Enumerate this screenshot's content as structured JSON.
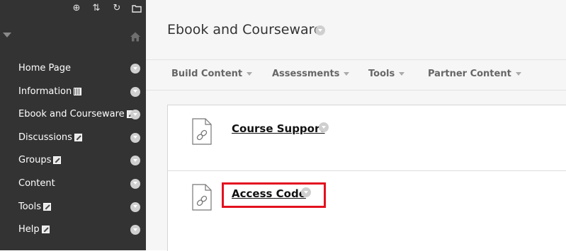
{
  "sidebar": {
    "tools": [
      {
        "icon": "add-circle-icon",
        "glyph": "⊕"
      },
      {
        "icon": "reorder-arrows-icon",
        "glyph": "⇅"
      },
      {
        "icon": "refresh-icon",
        "glyph": "↻"
      },
      {
        "icon": "folder-icon",
        "glyph": "▭"
      }
    ],
    "items": [
      {
        "label": "Home Page",
        "icon": null
      },
      {
        "label": "Information",
        "icon": "grid"
      },
      {
        "label": "Ebook and Courseware",
        "icon": "pencil"
      },
      {
        "label": "Discussions",
        "icon": "pencil"
      },
      {
        "label": "Groups",
        "icon": "pencil"
      },
      {
        "label": "Content",
        "icon": null
      },
      {
        "label": "Tools",
        "icon": "pencil"
      },
      {
        "label": "Help",
        "icon": "pencil"
      }
    ]
  },
  "header": {
    "title": "Ebook and Courseware"
  },
  "actionbar": {
    "items": [
      {
        "label": "Build Content"
      },
      {
        "label": "Assessments"
      },
      {
        "label": "Tools"
      },
      {
        "label": "Partner Content"
      }
    ]
  },
  "content": {
    "items": [
      {
        "title": "Course Support"
      },
      {
        "title": "Access Code"
      }
    ]
  },
  "colors": {
    "sidebar_bg": "#333333",
    "highlight": "#e3101f"
  }
}
